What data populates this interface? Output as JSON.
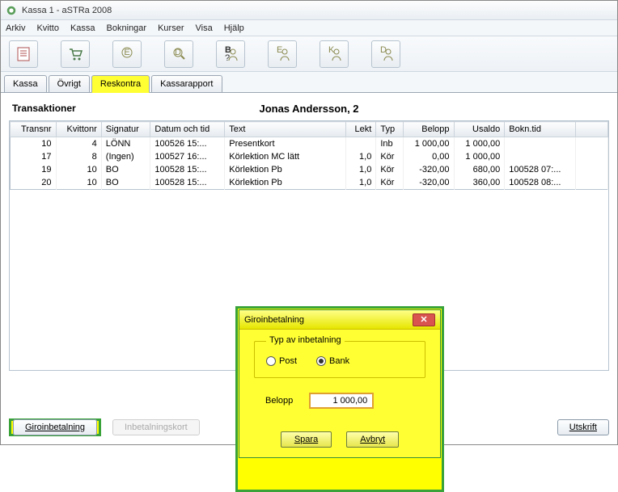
{
  "window": {
    "title": "Kassa 1 - aSTRa 2008"
  },
  "menu": {
    "items": [
      "Arkiv",
      "Kvitto",
      "Kassa",
      "Bokningar",
      "Kurser",
      "Visa",
      "Hjälp"
    ]
  },
  "toolbar": {
    "icons": [
      "notepad-icon",
      "cart-icon",
      "stamp-e-icon",
      "magnify-e-icon",
      "person-b-q-icon",
      "person-e-icon",
      "person-k-icon",
      "person-d-icon"
    ]
  },
  "tabs": {
    "items": [
      {
        "label": "Kassa",
        "active": false
      },
      {
        "label": "Övrigt",
        "active": false
      },
      {
        "label": "Reskontra",
        "active": true
      },
      {
        "label": "Kassarapport",
        "active": false
      }
    ]
  },
  "page": {
    "section_label": "Transaktioner",
    "customer": "Jonas Andersson, 2"
  },
  "grid": {
    "columns": [
      "Transnr",
      "Kvittonr",
      "Signatur",
      "Datum och tid",
      "Text",
      "Lekt",
      "Typ",
      "Belopp",
      "Usaldo",
      "Bokn.tid"
    ],
    "rows": [
      {
        "transnr": "10",
        "kvittonr": "4",
        "signatur": "LÖNN",
        "datum": "100526 15:...",
        "text": "Presentkort",
        "lekt": "",
        "typ": "Inb",
        "belopp": "1 000,00",
        "usaldo": "1 000,00",
        "bokn": ""
      },
      {
        "transnr": "17",
        "kvittonr": "8",
        "signatur": "(Ingen)",
        "datum": "100527 16:...",
        "text": "Körlektion MC lätt",
        "lekt": "1,0",
        "typ": "Kör",
        "belopp": "0,00",
        "usaldo": "1 000,00",
        "bokn": ""
      },
      {
        "transnr": "19",
        "kvittonr": "10",
        "signatur": "BO",
        "datum": "100528 15:...",
        "text": "Körlektion Pb",
        "lekt": "1,0",
        "typ": "Kör",
        "belopp": "-320,00",
        "usaldo": "680,00",
        "bokn": "100528 07:..."
      },
      {
        "transnr": "20",
        "kvittonr": "10",
        "signatur": "BO",
        "datum": "100528 15:...",
        "text": "Körlektion Pb",
        "lekt": "1,0",
        "typ": "Kör",
        "belopp": "-320,00",
        "usaldo": "360,00",
        "bokn": "100528 08:..."
      }
    ]
  },
  "buttons": {
    "giro": "Giroinbetalning",
    "inbetalningskort": "Inbetalningskort",
    "utskrift": "Utskrift"
  },
  "dialog": {
    "title": "Giroinbetalning",
    "group_label": "Typ av inbetalning",
    "radio_post": "Post",
    "radio_bank": "Bank",
    "selected": "bank",
    "amount_label": "Belopp",
    "amount_value": "1 000,00",
    "save": "Spara",
    "cancel": "Avbryt"
  }
}
